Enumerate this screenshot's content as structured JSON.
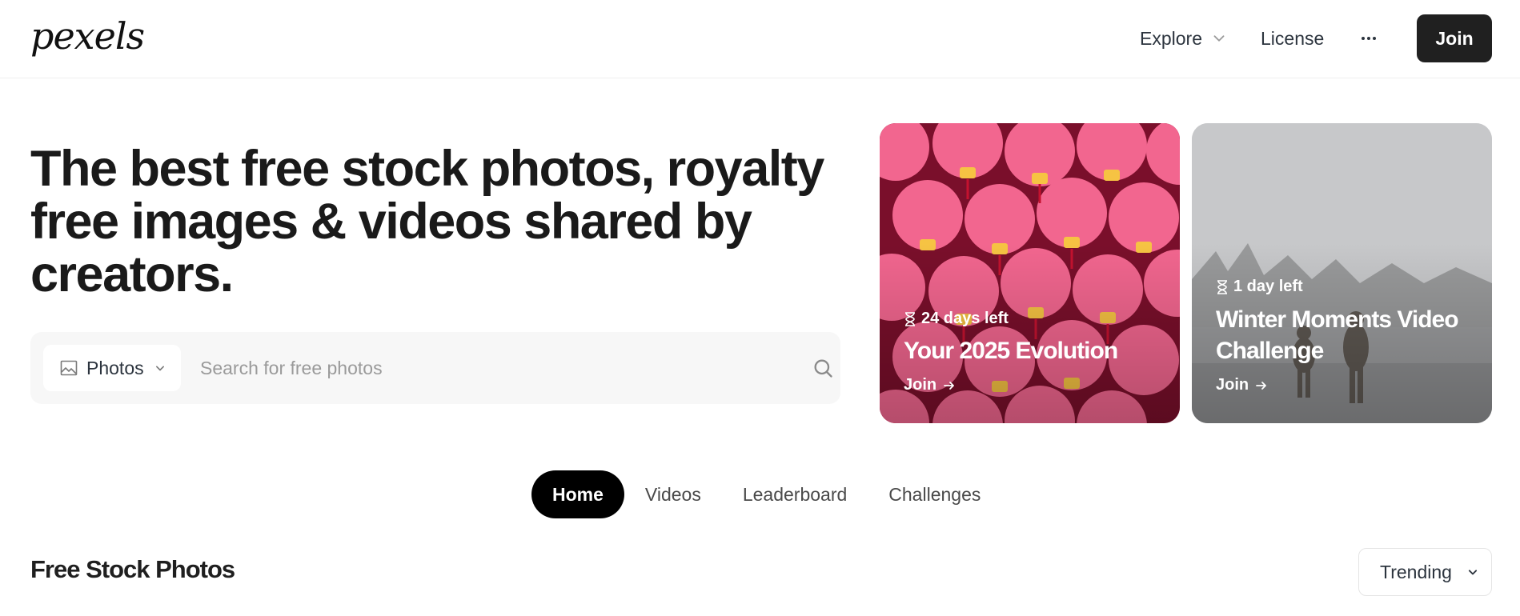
{
  "brand": {
    "logo_text": "pexels"
  },
  "nav": {
    "explore_label": "Explore",
    "license_label": "License",
    "more_label": "···",
    "join_label": "Join"
  },
  "hero": {
    "title": "The best free stock photos, royalty free images & videos shared by creators."
  },
  "search": {
    "type_label": "Photos",
    "placeholder": "Search for free photos",
    "value": ""
  },
  "challenges": [
    {
      "time_left": "24 days left",
      "title": "Your 2025 Evolution",
      "join_label": "Join"
    },
    {
      "time_left": "1 day left",
      "title": "Winter Moments Video Challenge",
      "join_label": "Join"
    }
  ],
  "tabs": [
    {
      "label": "Home",
      "active": true
    },
    {
      "label": "Videos",
      "active": false
    },
    {
      "label": "Leaderboard",
      "active": false
    },
    {
      "label": "Challenges",
      "active": false
    }
  ],
  "section": {
    "title": "Free Stock Photos",
    "sort_label": "Trending"
  },
  "colors": {
    "join_button": "#202020",
    "active_tab": "#000000",
    "search_bg": "#f7f7f7",
    "lantern_pink": "#e85b84"
  }
}
